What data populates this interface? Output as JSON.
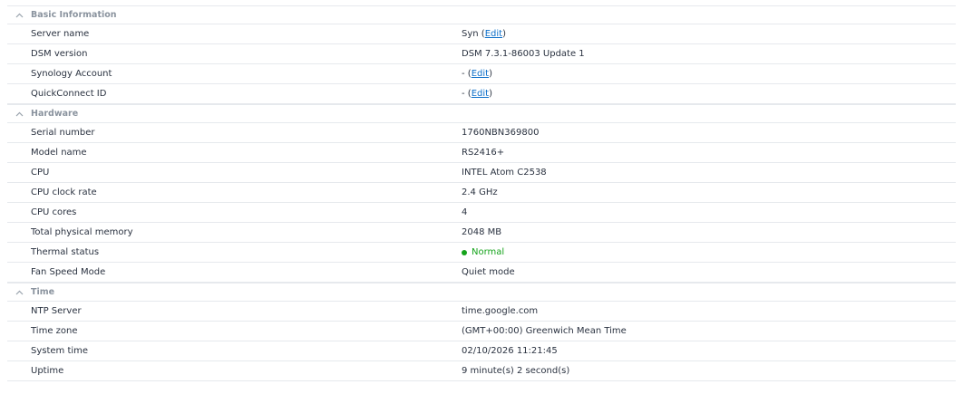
{
  "colors": {
    "link": "#0d6fc9",
    "status_normal": "#15a31b",
    "section_header": "#8a939e"
  },
  "basic": {
    "title": "Basic Information",
    "server_name": {
      "label": "Server name",
      "value": "Syn",
      "open": "(",
      "edit": "Edit",
      "close": ")"
    },
    "dsm_version": {
      "label": "DSM version",
      "value": "DSM 7.3.1-86003 Update 1"
    },
    "synology_account": {
      "label": "Synology Account",
      "value": "-",
      "open": "(",
      "edit": "Edit",
      "close": ")"
    },
    "quickconnect": {
      "label": "QuickConnect ID",
      "value": "-",
      "open": "(",
      "edit": "Edit",
      "close": ")"
    }
  },
  "hardware": {
    "title": "Hardware",
    "serial": {
      "label": "Serial number",
      "value": "1760NBN369800"
    },
    "model": {
      "label": "Model name",
      "value": "RS2416+"
    },
    "cpu": {
      "label": "CPU",
      "value": "INTEL Atom C2538"
    },
    "clock": {
      "label": "CPU clock rate",
      "value": "2.4 GHz"
    },
    "cores": {
      "label": "CPU cores",
      "value": "4"
    },
    "memory": {
      "label": "Total physical memory",
      "value": "2048 MB"
    },
    "thermal": {
      "label": "Thermal status",
      "value": "Normal"
    },
    "fan": {
      "label": "Fan Speed Mode",
      "value": "Quiet mode"
    }
  },
  "time": {
    "title": "Time",
    "ntp": {
      "label": "NTP Server",
      "value": "time.google.com"
    },
    "zone": {
      "label": "Time zone",
      "value": "(GMT+00:00) Greenwich Mean Time"
    },
    "system_time": {
      "label": "System time",
      "value": "02/10/2026 11:21:45"
    },
    "uptime": {
      "label": "Uptime",
      "value": "9 minute(s) 2 second(s)"
    }
  }
}
